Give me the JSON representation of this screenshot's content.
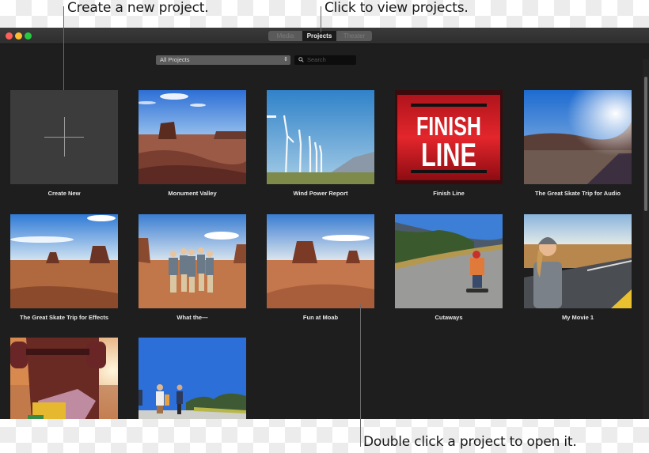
{
  "callouts": {
    "create": "Create a new project.",
    "view": "Click to view projects.",
    "open": "Double click a project to open it."
  },
  "window": {
    "traffic_lights": [
      {
        "name": "close",
        "color": "#ff5f57"
      },
      {
        "name": "minimize",
        "color": "#febc2e"
      },
      {
        "name": "zoom",
        "color": "#28c840"
      }
    ],
    "tabs": [
      {
        "label": "Media",
        "active": false
      },
      {
        "label": "Projects",
        "active": true
      },
      {
        "label": "Theater",
        "active": false
      }
    ],
    "filter": {
      "selected": "All Projects",
      "icon": "updown-chevron-icon"
    },
    "search": {
      "placeholder": "Search",
      "icon": "magnifier-icon"
    }
  },
  "create_new": {
    "label": "Create New",
    "icon": "plus-icon"
  },
  "projects": [
    {
      "title": "Monument Valley",
      "thumb": "monument-valley"
    },
    {
      "title": "Wind Power Report",
      "thumb": "wind-turbines"
    },
    {
      "title": "Finish Line",
      "thumb": "finish-line",
      "thumb_text": [
        "FINISH",
        "LINE"
      ]
    },
    {
      "title": "The Great Skate Trip for Audio",
      "thumb": "sunset-road"
    },
    {
      "title": "The Great Skate Trip for Effects",
      "thumb": "desert-buttes"
    },
    {
      "title": "What the—",
      "thumb": "group-photo"
    },
    {
      "title": "Fun at Moab",
      "thumb": "mitten-butte"
    },
    {
      "title": "Cutaways",
      "thumb": "skateboarder"
    },
    {
      "title": "My Movie 1",
      "thumb": "helmet-selfie"
    },
    {
      "title": "",
      "thumb": "skateboard-underside"
    },
    {
      "title": "",
      "thumb": "walking-group"
    }
  ]
}
